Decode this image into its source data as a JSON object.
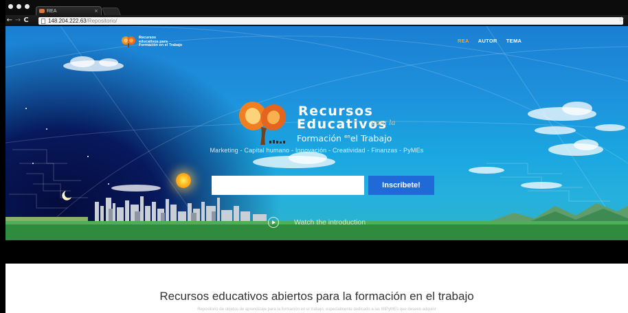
{
  "browser": {
    "tab_title": "REA",
    "tab_close": "×",
    "url_host": "148.204.222.63",
    "url_path": "/Repositorio/",
    "back": "←",
    "forward": "→",
    "reload": "C",
    "bookmark_star": "☆"
  },
  "site": {
    "logo_small_text": "Recursos\neducativos para\nFormación en el Trabajo",
    "nav": [
      "REA",
      "AUTOR",
      "TEMA"
    ],
    "active_nav": "REA",
    "accent_color": "#f5a623"
  },
  "hero": {
    "brand_line1": "Recursos",
    "brand_line2": "Educativos",
    "brand_para": "para la",
    "brand_formacion": "Formación",
    "brand_en": "en",
    "brand_el_trabajo": "el Trabajo",
    "tagline": "Marketing - Capital humano - Innovación - Creatividad - Finanzas - PyMEs",
    "email_placeholder": "",
    "signup_button": "Inscribete!",
    "watch_intro": "Watch the introduction",
    "button_color": "#1f6ad6"
  },
  "main": {
    "title": "Recursos educativos abiertos para la formación en el trabajo",
    "subtitle": "Repositorio de objetos de aprendizaje para la formación en el trabajo, especialmente dedicado a las MiPyMEs que deseen adquirir"
  },
  "icons": [
    "favicon-icon",
    "page-icon",
    "star-icon",
    "logo-icon",
    "play-icon",
    "sun-icon"
  ]
}
